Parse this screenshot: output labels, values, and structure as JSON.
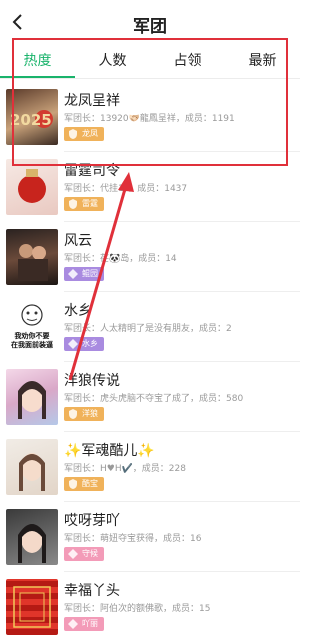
{
  "header": {
    "title": "军团"
  },
  "tabs": [
    {
      "label": "热度"
    },
    {
      "label": "人数"
    },
    {
      "label": "占领"
    },
    {
      "label": "最新"
    }
  ],
  "colors": {
    "accent": "#19b36b",
    "annotation": "#e0303a",
    "gold_badge": "#f0b25a",
    "purple_badge": "#a98be0",
    "pink_badge": "#f39bb8"
  },
  "rows": [
    {
      "name": "龙凤呈祥",
      "meta": "军团长：13920🫱🏻‍🫲🏼龍鳳呈祥，成员：1191",
      "badge": "龙凤"
    },
    {
      "name": "雷霆司令",
      "meta": "军团长：代挂1，，成员：1437",
      "badge": "雷霆"
    },
    {
      "name": "风云",
      "meta": "军团长：荏🐼岛，成员：14",
      "badge": "鲲园"
    },
    {
      "name": "水乡",
      "meta": "军团长：人太精明了是没有朋友，成员：2",
      "badge": "水乡",
      "avatar_text": [
        "我劝你不要",
        "在我面前装逼"
      ]
    },
    {
      "name": "洋狼传说",
      "meta": "军团长：虎头虎脑不夺宝了成了，成员：580",
      "badge": "洋狼"
    },
    {
      "name": "✨军魂酷儿✨",
      "meta": "军团长：H♥H✔️，成员：228",
      "badge": "酷宝"
    },
    {
      "name": "哎呀芽吖",
      "meta": "军团长：萌妞夺宝获得，成员：16",
      "badge": "守候"
    },
    {
      "name": "幸福丫头",
      "meta": "军团长：阿伯次的额佛歌，成员：15",
      "badge": "吖丽"
    }
  ]
}
